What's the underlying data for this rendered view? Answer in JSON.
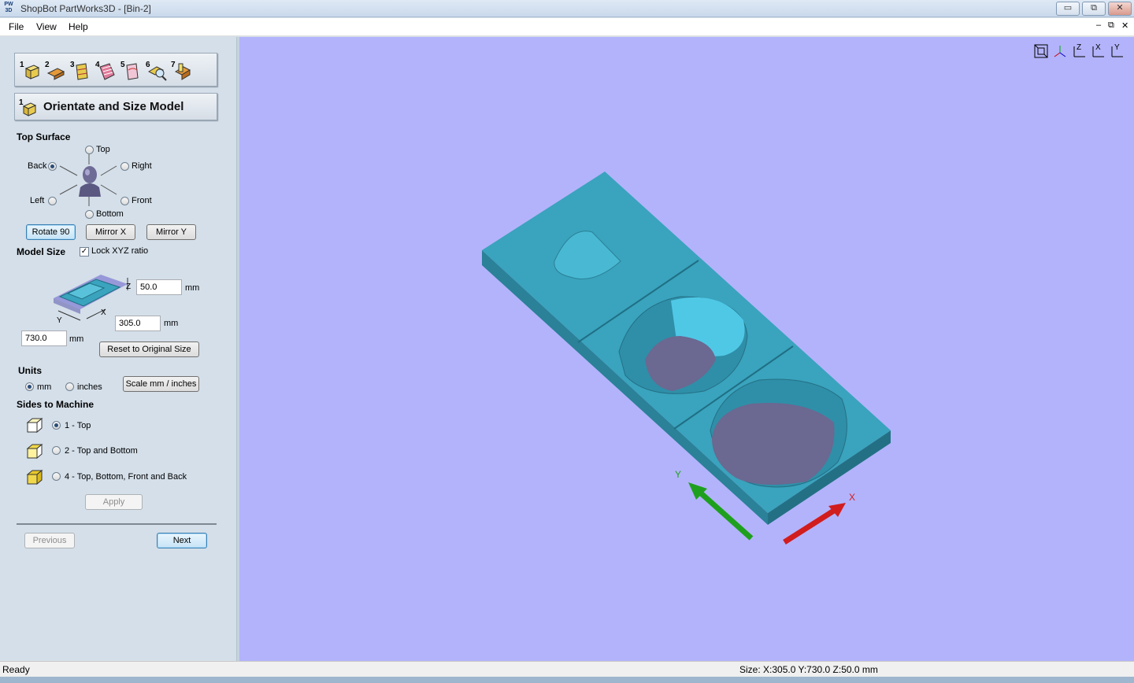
{
  "window": {
    "title": "ShopBot PartWorks3D - [Bin-2]",
    "app_icon_text": "PW 3D",
    "minimize": "▭",
    "restore": "⧉",
    "close": "✕"
  },
  "menu": {
    "items": [
      "File",
      "View",
      "Help"
    ],
    "mdi_minimize": "–",
    "mdi_restore": "⧉",
    "mdi_close": "✕"
  },
  "toolbar": {
    "steps": [
      "1",
      "2",
      "3",
      "4",
      "5",
      "6",
      "7"
    ]
  },
  "section": {
    "number": "1",
    "title": "Orientate and Size Model"
  },
  "top_surface": {
    "heading": "Top Surface",
    "options": {
      "top": "Top",
      "back": "Back",
      "right": "Right",
      "left": "Left",
      "front": "Front",
      "bottom": "Bottom"
    },
    "selected": "Back",
    "buttons": {
      "rotate": "Rotate 90",
      "mirror_x": "Mirror X",
      "mirror_y": "Mirror Y"
    }
  },
  "model_size": {
    "heading": "Model Size",
    "lock_label": "Lock XYZ ratio",
    "lock_checked": true,
    "z_value": "50.0",
    "x_value": "305.0",
    "y_value": "730.0",
    "unit": "mm",
    "axis_z": "Z",
    "axis_x": "X",
    "axis_y": "Y",
    "reset_label": "Reset to Original Size"
  },
  "units": {
    "heading": "Units",
    "mm": "mm",
    "inches": "inches",
    "selected": "mm",
    "scale_label": "Scale mm / inches"
  },
  "sides": {
    "heading": "Sides to Machine",
    "options": [
      "1 - Top",
      "2 - Top and Bottom",
      "4 - Top, Bottom, Front and Back"
    ],
    "selected_index": 0,
    "apply_label": "Apply"
  },
  "nav": {
    "previous": "Previous",
    "next": "Next"
  },
  "viewport": {
    "background": "#b3b3fb",
    "model_color": "#3aa3bd",
    "view_icons": [
      "zoom-fit-icon",
      "iso-view-icon",
      "z-view-icon",
      "x-view-icon",
      "y-view-icon"
    ],
    "view_labels": [
      "",
      "Z",
      "Z",
      "X",
      "Y"
    ],
    "axis_x_label": "X",
    "axis_y_label": "Y"
  },
  "status": {
    "left": "Ready",
    "size": "Size: X:305.0 Y:730.0 Z:50.0 mm"
  }
}
